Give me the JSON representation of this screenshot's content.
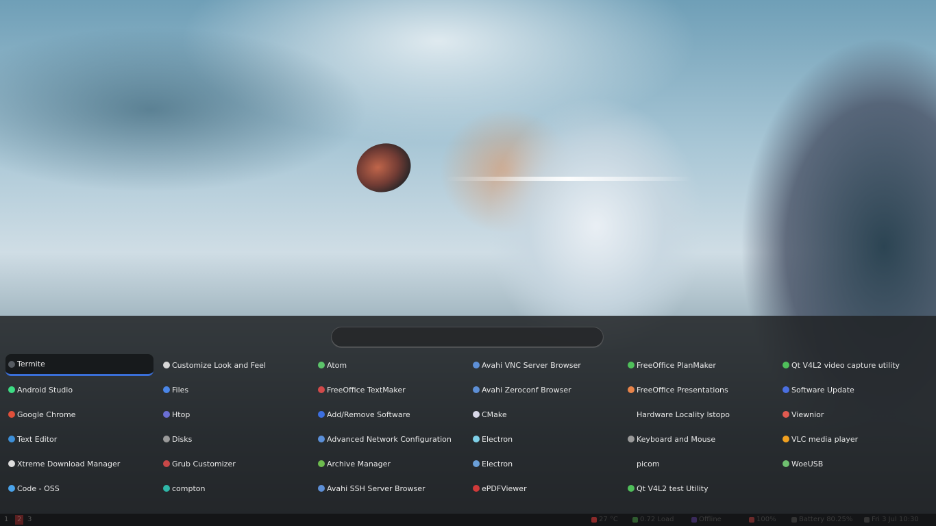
{
  "search": {
    "value": "",
    "placeholder": ""
  },
  "apps": [
    [
      {
        "label": "Termite",
        "icon": "terminal-icon",
        "color": "#555a60",
        "selected": true
      },
      {
        "label": "Android Studio",
        "icon": "android-studio-icon",
        "color": "#3ddc84"
      },
      {
        "label": "Google Chrome",
        "icon": "chrome-icon",
        "color": "#e04f3a"
      },
      {
        "label": "Text Editor",
        "icon": "text-editor-icon",
        "color": "#3d8fd8"
      },
      {
        "label": "Xtreme Download Manager",
        "icon": "download-manager-icon",
        "color": "#dddddd"
      },
      {
        "label": "Code - OSS",
        "icon": "vscode-icon",
        "color": "#4aa3ea"
      }
    ],
    [
      {
        "label": "Customize Look and Feel",
        "icon": "appearance-icon",
        "color": "#d8d8d8"
      },
      {
        "label": "Files",
        "icon": "files-icon",
        "color": "#4a86e8"
      },
      {
        "label": "Htop",
        "icon": "htop-icon",
        "color": "#6b6fd4"
      },
      {
        "label": "Disks",
        "icon": "disks-icon",
        "color": "#9a9a9a"
      },
      {
        "label": "Grub Customizer",
        "icon": "grub-icon",
        "color": "#c84848"
      },
      {
        "label": "compton",
        "icon": "compton-icon",
        "color": "#2fb7a8"
      }
    ],
    [
      {
        "label": "Atom",
        "icon": "atom-icon",
        "color": "#5cc46a"
      },
      {
        "label": "FreeOffice TextMaker",
        "icon": "textmaker-icon",
        "color": "#d24a4a"
      },
      {
        "label": "Add/Remove Software",
        "icon": "software-icon",
        "color": "#3c6fe0"
      },
      {
        "label": "Advanced Network Configuration",
        "icon": "network-icon",
        "color": "#5b8fd8"
      },
      {
        "label": "Archive Manager",
        "icon": "archive-icon",
        "color": "#6dbb4e"
      },
      {
        "label": "Avahi SSH Server Browser",
        "icon": "avahi-ssh-icon",
        "color": "#5d8fd6"
      }
    ],
    [
      {
        "label": "Avahi VNC Server Browser",
        "icon": "avahi-vnc-icon",
        "color": "#5d8fd6"
      },
      {
        "label": "Avahi Zeroconf Browser",
        "icon": "avahi-zeroconf-icon",
        "color": "#5d8fd6"
      },
      {
        "label": "CMake",
        "icon": "cmake-icon",
        "color": "#d8d8e8"
      },
      {
        "label": "Electron",
        "icon": "electron-icon",
        "color": "#7fd0e8"
      },
      {
        "label": "Electron",
        "icon": "electron-icon",
        "color": "#6a9fd8"
      },
      {
        "label": "ePDFViewer",
        "icon": "pdf-viewer-icon",
        "color": "#d03a3a"
      }
    ],
    [
      {
        "label": "FreeOffice PlanMaker",
        "icon": "planmaker-icon",
        "color": "#4fbf5a"
      },
      {
        "label": "FreeOffice Presentations",
        "icon": "presentations-icon",
        "color": "#e8844a"
      },
      {
        "label": "Hardware Locality lstopo",
        "icon": "lstopo-icon",
        "color": "transparent"
      },
      {
        "label": "Keyboard and Mouse",
        "icon": "keyboard-icon",
        "color": "#9a9a9a"
      },
      {
        "label": "picom",
        "icon": "picom-icon",
        "color": "transparent"
      },
      {
        "label": "Qt V4L2 test Utility",
        "icon": "qt-v4l2-test-icon",
        "color": "#4fbf5a"
      }
    ],
    [
      {
        "label": "Qt V4L2 video capture utility",
        "icon": "qt-v4l2-capture-icon",
        "color": "#4fbf5a"
      },
      {
        "label": "Software Update",
        "icon": "software-update-icon",
        "color": "#4a6fe0"
      },
      {
        "label": "Viewnior",
        "icon": "viewnior-icon",
        "color": "#e05a50"
      },
      {
        "label": "VLC media player",
        "icon": "vlc-icon",
        "color": "#f0a020"
      },
      {
        "label": "WoeUSB",
        "icon": "woeusb-icon",
        "color": "#6fbf6f"
      }
    ]
  ],
  "bar": {
    "workspaces": [
      {
        "label": "1",
        "active": false
      },
      {
        "label": "2",
        "active": true
      },
      {
        "label": "3",
        "active": false
      }
    ],
    "modules": [
      {
        "name": "temperature",
        "label": "27 °C",
        "color": "#8a2a2a"
      },
      {
        "name": "load",
        "label": "0.72 Load",
        "color": "#2f5a2f"
      },
      {
        "name": "network",
        "label": "Offline",
        "color": "#3a2a5a"
      },
      {
        "name": "volume",
        "label": "100%",
        "color": "#6a2a2a"
      },
      {
        "name": "battery",
        "label": "Battery 80.25%",
        "color": "#333333"
      },
      {
        "name": "clock",
        "label": "Fri 3 Jul 10:30",
        "color": "#333333"
      }
    ]
  }
}
